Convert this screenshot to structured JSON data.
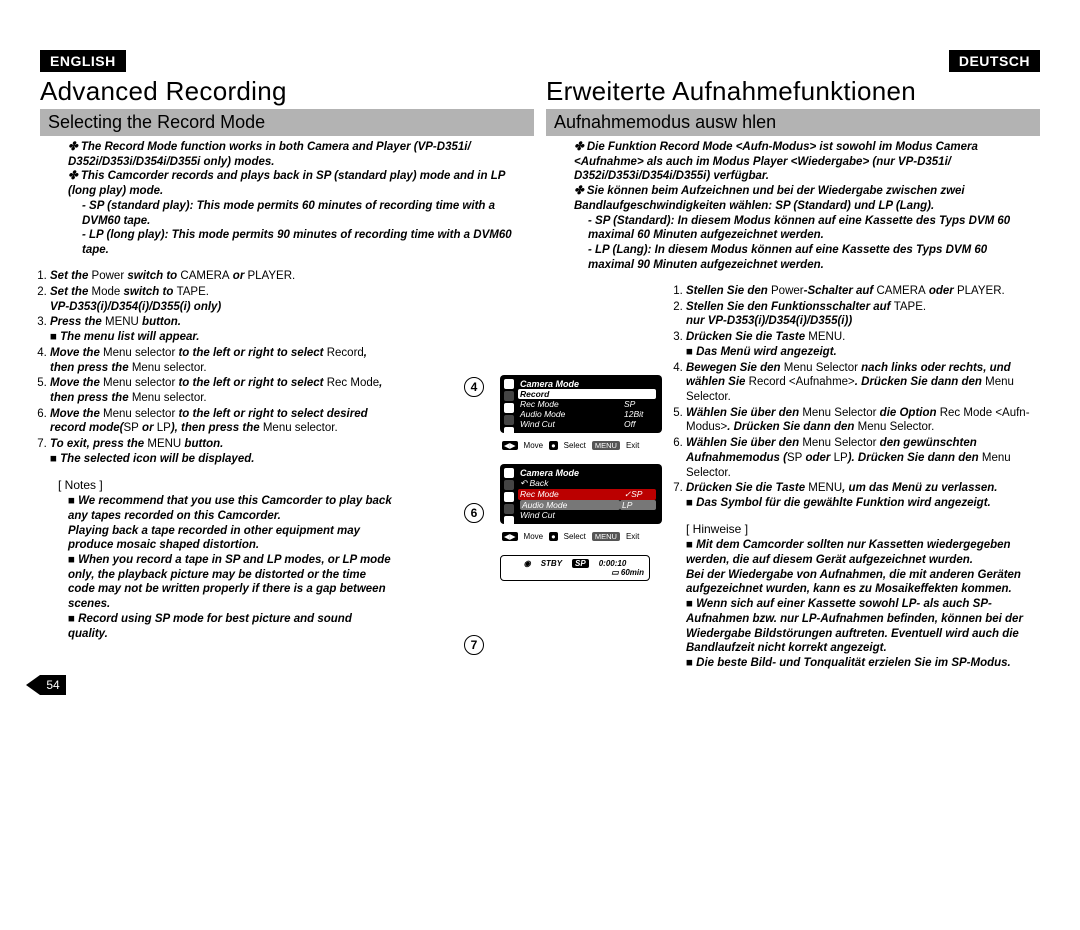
{
  "page_number": "54",
  "left": {
    "lang": "ENGLISH",
    "title": "Advanced Recording",
    "subtitle": "Selecting the Record Mode",
    "intro1": "The Record Mode function works in both Camera and Player (VP-D351i/ D352i/D353i/D354i/D355i only) modes.",
    "intro2": "This Camcorder records and plays back in SP (standard play) mode and in LP (long play) mode.",
    "sp": "SP (standard play): This mode permits 60 minutes of recording time with a DVM60 tape.",
    "lp": "LP (long play): This mode permits 90 minutes of recording time with a DVM60 tape.",
    "s1a": "Set the ",
    "s1b": "Power",
    "s1c": " switch to ",
    "s1d": "CAMERA",
    "s1e": " or ",
    "s1f": "PLAYER",
    "s1g": ".",
    "s2a": "Set the ",
    "s2b": "Mode",
    "s2c": " switch to ",
    "s2d": "TAPE",
    "s2e": ".",
    "s2sub": "VP-D353(i)/D354(i)/D355(i) only)",
    "s3a": "Press the ",
    "s3b": "MENU",
    "s3c": " button.",
    "s3sub": "The menu list will appear.",
    "s4a": "Move the ",
    "s4b": "Menu selector",
    "s4c": " to the left or right to select ",
    "s4d": "Record",
    "s4e": ", then press the ",
    "s4f": "Menu selector",
    "s4g": ".",
    "s5a": "Move the ",
    "s5b": "Menu selector",
    "s5c": " to the left or right to select ",
    "s5d": "Rec Mode",
    "s5e": ", then press the ",
    "s5f": "Menu selector",
    "s5g": ".",
    "s6a": "Move the ",
    "s6b": "Menu selector",
    "s6c": " to the left or right to select desired record mode(",
    "s6d": "SP",
    "s6e": " or ",
    "s6f": "LP",
    "s6g": "), then press the ",
    "s6h": "Menu selector",
    "s6i": ".",
    "s7a": "To exit, press the ",
    "s7b": "MENU",
    "s7c": " button.",
    "s7sub": "The selected icon will be displayed.",
    "notes_label": "[ Notes ]",
    "n1": "We recommend that you use this Camcorder to play back any tapes recorded on this Camcorder.",
    "n2": "Playing back a tape recorded in other equipment may produce mosaic shaped distortion.",
    "n3": "When you record a tape in SP and LP modes, or LP mode only, the playback picture may be distorted or the time code may not be written properly if there is a gap between scenes.",
    "n4": "Record using SP mode for best picture and sound quality."
  },
  "right": {
    "lang": "DEUTSCH",
    "title": "Erweiterte Aufnahmefunktionen",
    "subtitle": "Aufnahmemodus ausw hlen",
    "intro1": "Die Funktion Record Mode <Aufn-Modus> ist sowohl im Modus Camera <Aufnahme> als auch im Modus Player <Wiedergabe> (nur VP-D351i/ D352i/D353i/D354i/D355i) verfügbar.",
    "intro2": "Sie können beim Aufzeichnen und bei der Wiedergabe zwischen zwei Bandlaufgeschwindigkeiten wählen: SP (Standard) und LP (Lang).",
    "sp": "SP (Standard): In diesem Modus können auf eine Kassette des Typs DVM 60 maximal 60 Minuten aufgezeichnet werden.",
    "lp": "LP (Lang): In diesem Modus können auf eine Kassette des Typs DVM 60 maximal 90 Minuten aufgezeichnet werden.",
    "s1a": "Stellen Sie den ",
    "s1b": "Power",
    "s1c": "-Schalter auf ",
    "s1d": "CAMERA",
    "s1e": " oder ",
    "s1f": "PLAYER",
    "s1g": ".",
    "s2a": "Stellen Sie den Funktionsschalter auf ",
    "s2b": "TAPE",
    "s2c": ".",
    "s2sub": "nur VP-D353(i)/D354(i)/D355(i))",
    "s3a": "Drücken Sie die Taste ",
    "s3b": "MENU",
    "s3c": ".",
    "s3sub": "Das Menü wird angezeigt.",
    "s4a": "Bewegen Sie den ",
    "s4b": "Menu Selector",
    "s4c": " nach links oder rechts, und wählen Sie ",
    "s4d": "Record <Aufnahme>",
    "s4e": ". Drücken Sie dann den ",
    "s4f": "Menu Selector",
    "s4g": ".",
    "s5a": "Wählen Sie über den ",
    "s5b": "Menu Selector",
    "s5c": " die Option ",
    "s5d": "Rec Mode <Aufn-Modus>",
    "s5e": ". Drücken Sie dann den ",
    "s5f": "Menu Selector",
    "s5g": ".",
    "s6a": "Wählen Sie über den ",
    "s6b": "Menu Selector",
    "s6c": " den gewünschten Aufnahmemodus (",
    "s6d": "SP",
    "s6e": " oder ",
    "s6f": "LP",
    "s6g": "). Drücken Sie dann den ",
    "s6h": "Menu Selector",
    "s6i": ".",
    "s7a": "Drücken Sie die Taste ",
    "s7b": "MENU",
    "s7c": ", um das Menü zu verlassen.",
    "s7sub": "Das Symbol für die gewählte Funktion wird angezeigt.",
    "notes_label": "[ Hinweise ]",
    "n1": "Mit dem Camcorder sollten nur Kassetten wiedergegeben werden, die auf diesem Gerät aufgezeichnet wurden.",
    "n2": "Bei der Wiedergabe von Aufnahmen, die mit anderen Geräten aufgezeichnet wurden, kann es zu Mosaikeffekten kommen.",
    "n3": "Wenn sich auf einer Kassette sowohl LP- als auch SP-Aufnahmen bzw. nur LP-Aufnahmen befinden, können bei der Wiedergabe Bildstörungen auftreten. Eventuell wird auch die Bandlaufzeit nicht korrekt angezeigt.",
    "n4": "Die beste Bild- und Tonqualität erzielen Sie im SP-Modus."
  },
  "fig": {
    "num4": "4",
    "num6": "6",
    "num7": "7",
    "menu1": {
      "title": "Camera Mode",
      "row_record": "Record",
      "r1l": "Rec Mode",
      "r1v": "SP",
      "r2l": "Audio Mode",
      "r2v": "12Bit",
      "r3l": "Wind Cut",
      "r3v": "Off"
    },
    "menu2": {
      "title": "Camera Mode",
      "back": "Back",
      "r1l": "Rec Mode",
      "r1v": "SP",
      "r2l": "Audio Mode",
      "r2v": "LP",
      "r3l": "Wind Cut"
    },
    "foot_move": "Move",
    "foot_select": "Select",
    "foot_menu": "MENU",
    "foot_exit": "Exit",
    "stby": "STBY",
    "stby_mode": "SP",
    "stby_time": "0:00:10",
    "stby_remain": "60min"
  }
}
